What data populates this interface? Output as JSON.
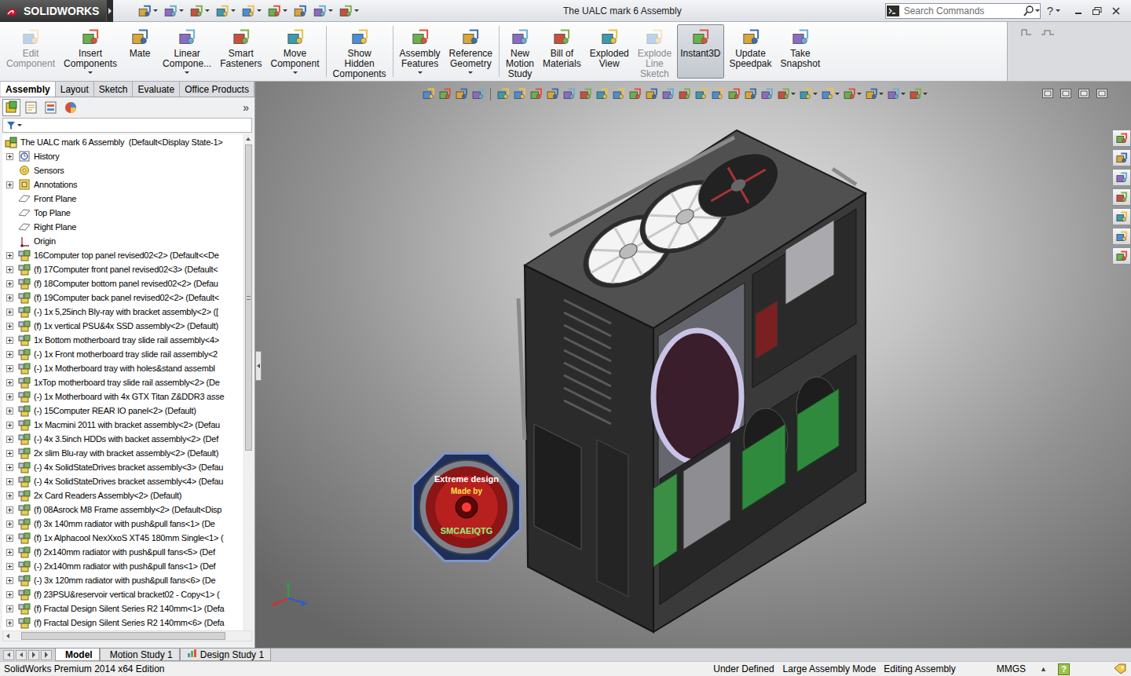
{
  "window": {
    "title": "The UALC mark 6 Assembly",
    "logo": "SOLIDWORKS",
    "help": "?"
  },
  "search": {
    "placeholder": "Search Commands"
  },
  "ribbon": {
    "groups": [
      [
        {
          "lines": [
            "Edit",
            "Component"
          ],
          "disabled": true,
          "selected": false,
          "has_menu": false
        },
        {
          "lines": [
            "Insert",
            "Components"
          ],
          "disabled": false,
          "selected": false,
          "has_menu": true
        },
        {
          "lines": [
            "Mate"
          ],
          "disabled": false,
          "selected": false,
          "has_menu": false
        },
        {
          "lines": [
            "Linear",
            "Compone..."
          ],
          "disabled": false,
          "selected": false,
          "has_menu": true
        },
        {
          "lines": [
            "Smart",
            "Fasteners"
          ],
          "disabled": false,
          "selected": false,
          "has_menu": false
        },
        {
          "lines": [
            "Move",
            "Component"
          ],
          "disabled": false,
          "selected": false,
          "has_menu": true
        }
      ],
      [
        {
          "lines": [
            "Show",
            "Hidden",
            "Components"
          ],
          "disabled": false,
          "selected": false,
          "has_menu": false
        }
      ],
      [
        {
          "lines": [
            "Assembly",
            "Features"
          ],
          "disabled": false,
          "selected": false,
          "has_menu": true
        },
        {
          "lines": [
            "Reference",
            "Geometry"
          ],
          "disabled": false,
          "selected": false,
          "has_menu": true
        }
      ],
      [
        {
          "lines": [
            "New",
            "Motion",
            "Study"
          ],
          "disabled": false,
          "selected": false,
          "has_menu": false
        },
        {
          "lines": [
            "Bill of",
            "Materials"
          ],
          "disabled": false,
          "selected": false,
          "has_menu": false
        },
        {
          "lines": [
            "Exploded",
            "View"
          ],
          "disabled": false,
          "selected": false,
          "has_menu": false
        },
        {
          "lines": [
            "Explode",
            "Line",
            "Sketch"
          ],
          "disabled": true,
          "selected": false,
          "has_menu": false
        },
        {
          "lines": [
            "Instant3D"
          ],
          "disabled": false,
          "selected": true,
          "has_menu": false
        },
        {
          "lines": [
            "Update",
            "Speedpak"
          ],
          "disabled": false,
          "selected": false,
          "has_menu": false
        },
        {
          "lines": [
            "Take",
            "Snapshot"
          ],
          "disabled": false,
          "selected": false,
          "has_menu": false
        }
      ]
    ]
  },
  "command_tabs": [
    {
      "label": "Assembly",
      "selected": true
    },
    {
      "label": "Layout",
      "selected": false
    },
    {
      "label": "Sketch",
      "selected": false
    },
    {
      "label": "Evaluate",
      "selected": false
    },
    {
      "label": "Office Products",
      "selected": false
    }
  ],
  "panel_tabs": {
    "tabs": [
      {
        "selected": true
      },
      {
        "selected": false
      },
      {
        "selected": false
      },
      {
        "selected": false
      }
    ],
    "more": "»"
  },
  "tree": {
    "root": {
      "label": "The UALC mark 6 Assembly  (Default<Display State-1>",
      "kind": "root"
    },
    "items": [
      {
        "label": "History",
        "kind": "history",
        "expandable": true
      },
      {
        "label": "Sensors",
        "kind": "sensors",
        "expandable": false
      },
      {
        "label": "Annotations",
        "kind": "annotations",
        "expandable": true
      },
      {
        "label": "Front Plane",
        "kind": "plane",
        "expandable": false
      },
      {
        "label": "Top Plane",
        "kind": "plane",
        "expandable": false
      },
      {
        "label": "Right Plane",
        "kind": "plane",
        "expandable": false
      },
      {
        "label": "Origin",
        "kind": "origin",
        "expandable": false
      },
      {
        "label": "16Computer top panel revised02<2> (Default<<De",
        "kind": "component",
        "expandable": true
      },
      {
        "label": "(f) 17Computer front panel revised02<3> (Default<",
        "kind": "component",
        "expandable": true
      },
      {
        "label": "(f) 18Computer bottom panel revised02<2> (Defau",
        "kind": "component",
        "expandable": true
      },
      {
        "label": "(f) 19Computer back panel revised02<2> (Default<",
        "kind": "component",
        "expandable": true
      },
      {
        "label": "(-) 1x 5,25inch Bly-ray with bracket assembly<2> ([",
        "kind": "component",
        "expandable": true
      },
      {
        "label": "(f) 1x vertical PSU&4x SSD assembly<2> (Default)",
        "kind": "component",
        "expandable": true
      },
      {
        "label": "1x Bottom motherboard tray slide rail assembly<4>",
        "kind": "component",
        "expandable": true
      },
      {
        "label": "(-) 1x Front motherboard tray slide rail assembly<2",
        "kind": "component",
        "expandable": true
      },
      {
        "label": "(-) 1x Motherboard tray with holes&stand assembl",
        "kind": "component",
        "expandable": true
      },
      {
        "label": "1xTop motherboard tray slide rail assembly<2> (De",
        "kind": "component",
        "expandable": true
      },
      {
        "label": "(-) 1x Motherboard with 4x GTX Titan Z&DDR3 asse",
        "kind": "component",
        "expandable": true
      },
      {
        "label": "(-) 15Computer REAR IO panel<2> (Default)",
        "kind": "component",
        "expandable": true
      },
      {
        "label": "1x Macmini 2011 with bracket assembly<2> (Defau",
        "kind": "component",
        "expandable": true
      },
      {
        "label": "(-) 4x 3.5inch HDDs with backet assembly<2> (Def",
        "kind": "component",
        "expandable": true
      },
      {
        "label": "2x slim Blu-ray with bracket assembly<2> (Default)",
        "kind": "component",
        "expandable": true
      },
      {
        "label": "(-) 4x SolidStateDrives bracket assembly<3> (Defau",
        "kind": "component",
        "expandable": true
      },
      {
        "label": "(-) 4x SolidStateDrives bracket assembly<4> (Defau",
        "kind": "component",
        "expandable": true
      },
      {
        "label": "2x Card Readers Assembly<2> (Default)",
        "kind": "component",
        "expandable": true
      },
      {
        "label": "(f) 08Asrock M8 Frame assembly<2> (Default<Disp",
        "kind": "component",
        "expandable": true
      },
      {
        "label": "(f) 3x 140mm radiator with push&pull fans<1> (De",
        "kind": "component",
        "expandable": true
      },
      {
        "label": "(f) 1x Alphacool NexXxoS XT45 180mm Single<1> (",
        "kind": "component",
        "expandable": true
      },
      {
        "label": "(f) 2x140mm radiator with push&pull fans<5> (Def",
        "kind": "component",
        "expandable": true
      },
      {
        "label": "(-) 2x140mm radiator with push&pull fans<1> (Def",
        "kind": "component",
        "expandable": true
      },
      {
        "label": "(-) 3x 120mm radiator with push&pull fans<6> (De",
        "kind": "component",
        "expandable": true
      },
      {
        "label": "(f) 23PSU&reservoir vertical bracket02 - Copy<1> (",
        "kind": "component",
        "expandable": true
      },
      {
        "label": "(f) Fractal Design Silent Series R2 140mm<1> (Defa",
        "kind": "component",
        "expandable": true
      },
      {
        "label": "(f) Fractal Design Silent Series R2 140mm<6> (Defa",
        "kind": "component",
        "expandable": true
      }
    ]
  },
  "viewport": {
    "badge": {
      "top": "Extreme design",
      "middle": "Made by",
      "bottom": "SMCAEIQTG"
    }
  },
  "bottom_tabs": [
    {
      "label": "Model",
      "selected": true,
      "kind": "model"
    },
    {
      "label": "Motion Study 1",
      "selected": false,
      "kind": "motion"
    },
    {
      "label": "Design Study 1",
      "selected": false,
      "kind": "design"
    }
  ],
  "status_bar": {
    "edition": "SolidWorks Premium 2014 x64 Edition",
    "items": [
      "Under Defined",
      "Large Assembly Mode",
      "Editing Assembly"
    ],
    "units": "MMGS",
    "units_arrow": "▲",
    "help": "?"
  }
}
